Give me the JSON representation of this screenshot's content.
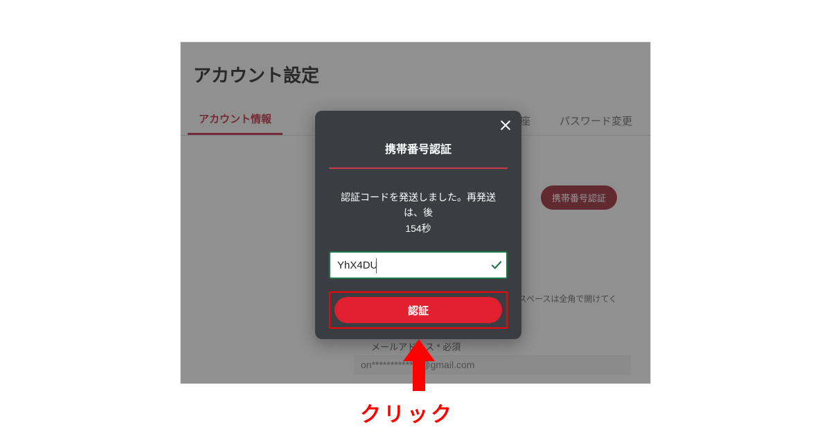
{
  "page": {
    "title": "アカウント設定"
  },
  "tabs": {
    "active": "アカウント情報",
    "partial1": "口座",
    "partial2": "パスワード変更"
  },
  "background": {
    "verify_badge": "携帯番号認証",
    "helper_text": "の間のスペースは全角で開けてく",
    "email_label": "メールアドレス * 必須",
    "email_value": "on*************@gmail.com"
  },
  "modal": {
    "title": "携帯番号認証",
    "message_line1": "認証コードを発送しました。再発送は、後",
    "message_line2": "154秒",
    "code_value": "YhX4DU",
    "submit_label": "認証"
  },
  "annotation": {
    "click_text": "クリック"
  },
  "colors": {
    "accent_red": "#b4182d",
    "bright_red": "#ff0000",
    "button_red": "#e2202f",
    "modal_bg": "#3a3e43",
    "valid_green": "#1f7a4a"
  }
}
